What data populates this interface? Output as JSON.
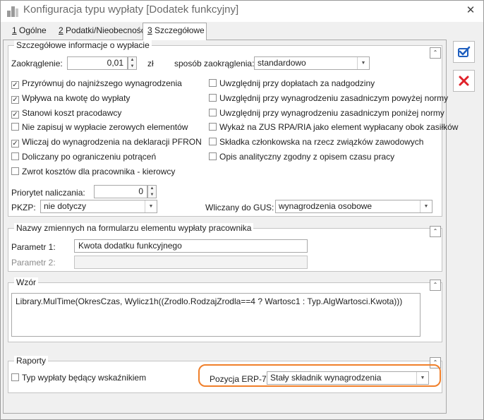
{
  "window": {
    "title": "Konfiguracja typu wypłaty [Dodatek funkcyjny]",
    "close_glyph": "✕"
  },
  "tabs": [
    {
      "num": "1",
      "label": " Ogólne"
    },
    {
      "num": "2",
      "label": " Podatki/Nieobecności"
    },
    {
      "num": "3",
      "label": " Szczegółowe"
    }
  ],
  "details": {
    "title": "Szczegółowe informacje o wypłacie",
    "rounding_label": "Zaokrąglenie:",
    "rounding_value": "0,01",
    "rounding_unit": "zł",
    "rounding_mode_label": "sposób zaokrąglenia:",
    "rounding_mode_value": "standardowo",
    "left_checks": [
      {
        "label": "Przyrównuj do najniższego wynagrodzenia",
        "mark": "✓"
      },
      {
        "label": "Wpływa na kwotę do wypłaty",
        "mark": "✓"
      },
      {
        "label": "Stanowi koszt pracodawcy",
        "mark": "✓"
      },
      {
        "label": "Nie zapisuj w wypłacie zerowych elementów",
        "mark": ""
      },
      {
        "label": "Wliczaj do wynagrodzenia na deklaracji PFRON",
        "mark": "✓"
      },
      {
        "label": "Doliczany po ograniczeniu potrąceń",
        "mark": ""
      },
      {
        "label": "Zwrot kosztów dla pracownika - kierowcy",
        "mark": ""
      }
    ],
    "right_checks": [
      {
        "label": "Uwzględnij przy dopłatach za nadgodziny",
        "mark": ""
      },
      {
        "label": "Uwzględnij przy wynagrodzeniu zasadniczym powyżej normy",
        "mark": ""
      },
      {
        "label": "Uwzględnij przy wynagrodzeniu zasadniczym poniżej normy",
        "mark": ""
      },
      {
        "label": "Wykaż na ZUS RPA/RIA jako element wypłacany obok zasiłków",
        "mark": ""
      },
      {
        "label": "Składka członkowska na rzecz związków zawodowych",
        "mark": ""
      },
      {
        "label": "Opis analityczny zgodny z opisem czasu pracy",
        "mark": ""
      }
    ],
    "priority_label": "Priorytet naliczania:",
    "priority_value": "0",
    "pkzp_label": "PKZP:",
    "pkzp_value": "nie dotyczy",
    "gus_label": "Wliczany do GUS:",
    "gus_value": "wynagrodzenia osobowe"
  },
  "variables": {
    "title": "Nazwy zmiennych na formularzu elementu wypłaty pracownika",
    "param1_label": "Parametr 1:",
    "param1_value": "Kwota dodatku funkcyjnego",
    "param2_label": "Parametr 2:",
    "param2_value": ""
  },
  "formula": {
    "title": "Wzór",
    "value": "Library.MulTime(OkresCzas, Wylicz1h((Zrodlo.RodzajZrodla==4 ? Wartosc1 : Typ.AlgWartosci.Kwota)))"
  },
  "reports": {
    "title": "Raporty",
    "indicator_label": "Typ wypłaty będący wskaźnikiem",
    "indicator_mark": "",
    "erp_label": "Pozycja ERP-7:",
    "erp_value": "Stały składnik wynagrodzenia"
  },
  "glyphs": {
    "collapse": "⌃",
    "dropdown": "▼",
    "spin_up": "▲",
    "spin_down": "▼"
  },
  "colors": {
    "highlight": "#f07f2a",
    "cancel": "#e0222a",
    "save": "#1f5fbf"
  }
}
